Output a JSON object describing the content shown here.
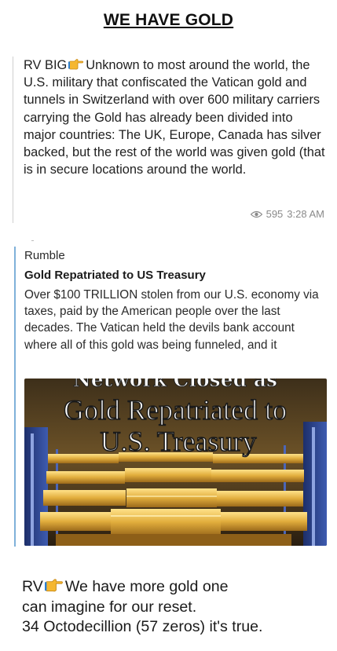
{
  "header": {
    "title": "WE HAVE GOLD"
  },
  "message1": {
    "prefix": "RV BIG",
    "body": "Unknown to most around the world, the U.S. military that confiscated the Vatican gold and tunnels in Switzerland with over 600 military carriers carrying the Gold has already been divided into major countries: The UK, Europe, Canada has silver backed, but the rest of the world was given gold (that is in secure locations around the world.",
    "views": "595",
    "time": "3:28 AM",
    "pointer_icon": "backhand-index-pointing-right-icon",
    "views_icon": "eye-icon"
  },
  "link_preview": {
    "source": "Rumble",
    "headline": "Gold Repatriated to US Treasury",
    "description": "Over $100 TRILLION stolen from our U.S. economy via taxes, paid by the American people over the last decades. The Vatican held the devils bank account where all of this gold was being funneled, and it",
    "thumbnail": {
      "top_text": "Network Closed as",
      "line1": "Gold Repatriated to",
      "line2": "U.S. Treasury"
    },
    "accent_color": "#7fb1d9"
  },
  "message2": {
    "prefix": "RV",
    "line1": "We have more gold one",
    "line2": "can imagine for our reset.",
    "line3": "34 Octodecillion (57 zeros) it's true."
  },
  "colors": {
    "gold": "#d8a83a",
    "text": "#1a1a1a",
    "meta": "#8a8a8a"
  }
}
